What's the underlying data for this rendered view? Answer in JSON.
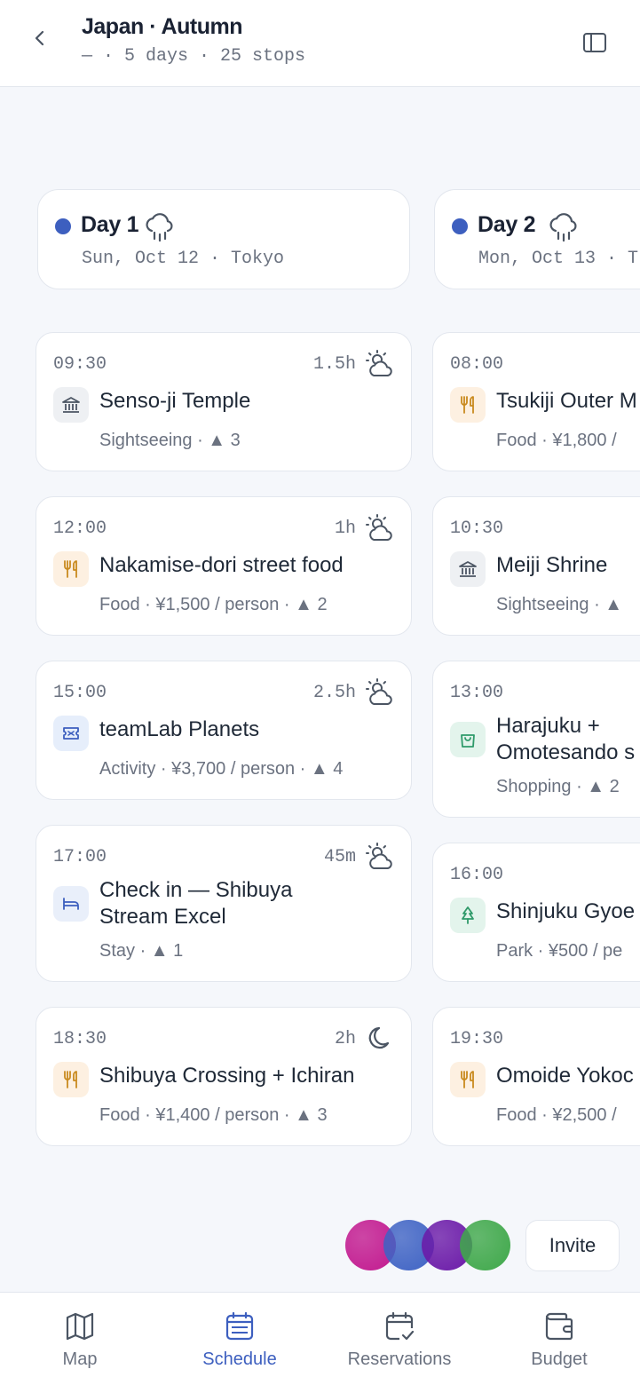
{
  "header": {
    "title": "Japan · Autumn",
    "subtitle": "— · 5 days · 25 stops"
  },
  "days": [
    {
      "title": "Day 1",
      "subtitle": "Sun, Oct 12 · Tokyo",
      "weather_icon": "rain-icon",
      "stops": [
        {
          "time": "09:30",
          "duration": "1.5h",
          "weather_icon": "partly-cloudy-icon",
          "category": "sight",
          "name": "Senso-ji Temple",
          "meta": "Sightseeing · ▲ 3"
        },
        {
          "time": "12:00",
          "duration": "1h",
          "weather_icon": "partly-cloudy-icon",
          "category": "food",
          "name": "Nakamise-dori street food",
          "meta": "Food · ¥1,500 / person · ▲ 2"
        },
        {
          "time": "15:00",
          "duration": "2.5h",
          "weather_icon": "partly-cloudy-icon",
          "category": "activity",
          "name": "teamLab Planets",
          "meta": "Activity · ¥3,700 / person · ▲ 4"
        },
        {
          "time": "17:00",
          "duration": "45m",
          "weather_icon": "partly-cloudy-icon",
          "category": "stay",
          "name": "Check in —  Shibuya",
          "name2": "Stream Excel",
          "meta": "Stay · ▲ 1"
        },
        {
          "time": "18:30",
          "duration": "2h",
          "weather_icon": "moon-icon",
          "category": "food",
          "name": "Shibuya Crossing + Ichiran",
          "meta": "Food · ¥1,400 / person · ▲ 3"
        }
      ]
    },
    {
      "title": "Day 2",
      "subtitle": "Mon, Oct 13 · T",
      "weather_icon": "rain-icon",
      "stops": [
        {
          "time": "08:00",
          "category": "food",
          "name": "Tsukiji Outer M",
          "meta": "Food · ¥1,800 /"
        },
        {
          "time": "10:30",
          "category": "sight",
          "name": "Meiji Shrine",
          "meta": "Sightseeing · ▲"
        },
        {
          "time": "13:00",
          "category": "shop",
          "name": "Harajuku +",
          "name2": "Omotesando s",
          "meta": "Shopping · ▲ 2"
        },
        {
          "time": "16:00",
          "category": "park",
          "name": "Shinjuku Gyoe",
          "meta": "Park · ¥500 / pe"
        },
        {
          "time": "19:30",
          "category": "food",
          "name": "Omoide Yokoc",
          "meta": "Food · ¥2,500 /"
        }
      ]
    }
  ],
  "invite": {
    "label": "Invite",
    "avatar_colors": [
      "#c2198f",
      "#3f63c4",
      "#6b1aa8",
      "#3fa84a"
    ]
  },
  "nav": [
    {
      "label": "Map",
      "icon": "map-icon",
      "active": false
    },
    {
      "label": "Schedule",
      "icon": "calendar-icon",
      "active": true
    },
    {
      "label": "Reservations",
      "icon": "calendar-check-icon",
      "active": false
    },
    {
      "label": "Budget",
      "icon": "wallet-icon",
      "active": false
    }
  ],
  "colors": {
    "accent": "#3d5fbf",
    "food": "#c98a1e",
    "sight": "#4b5563",
    "activity": "#3d5fbf",
    "shop": "#2f9a6a",
    "park": "#2f9a6a"
  }
}
